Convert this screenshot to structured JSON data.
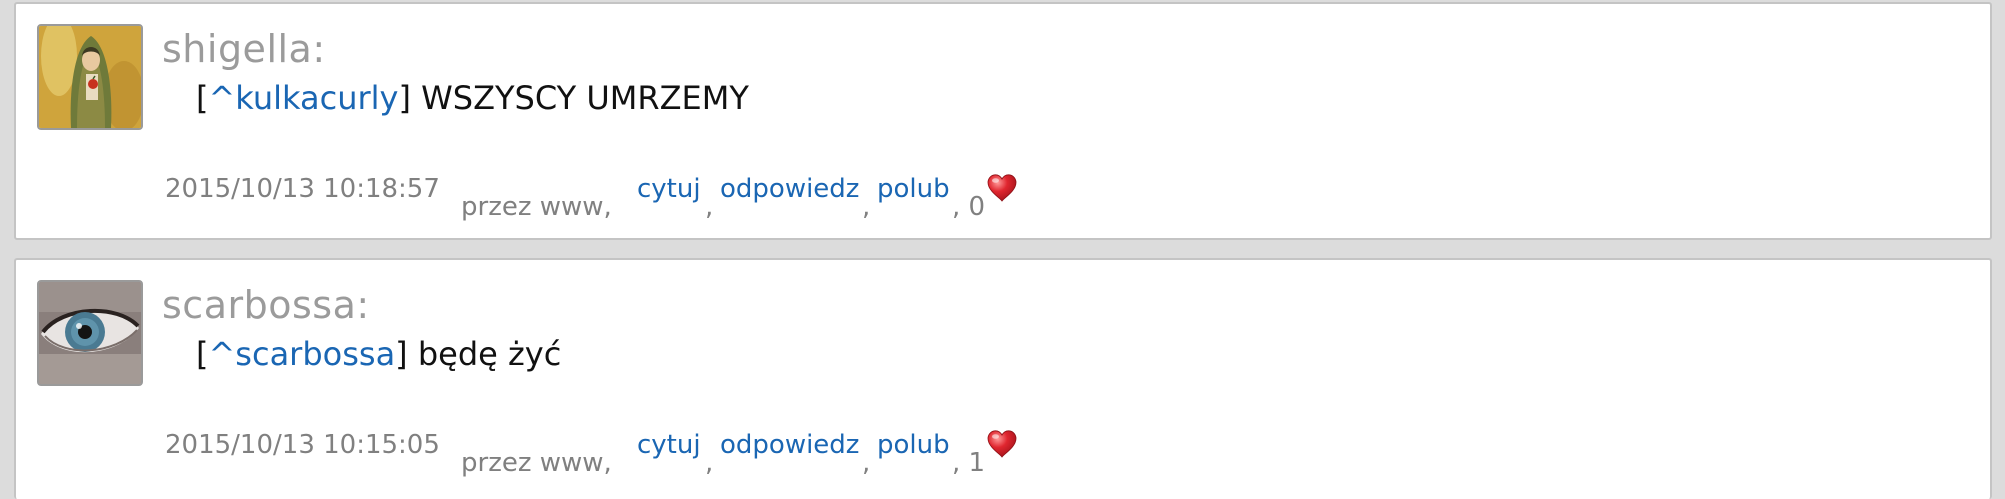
{
  "comments": [
    {
      "username": "shigella:",
      "reply_open": "[",
      "reply_to": "^kulkacurly",
      "reply_close": "]",
      "text": " WSZYSCY UMRZEMY",
      "timestamp": "2015/10/13 10:18:57",
      "via": "przez www,",
      "actions": {
        "quote": "cytuj",
        "reply": "odpowiedz",
        "like": "polub"
      },
      "separator": ",",
      "likes_text": ", 0",
      "avatar_icon": "woman-painting-avatar",
      "heart_color": "#e0262f"
    },
    {
      "username": "scarbossa:",
      "reply_open": "[",
      "reply_to": "^scarbossa",
      "reply_close": "]",
      "text": " będę żyć",
      "timestamp": "2015/10/13 10:15:05",
      "via": "przez www,",
      "actions": {
        "quote": "cytuj",
        "reply": "odpowiedz",
        "like": "polub"
      },
      "separator": ",",
      "likes_text": ", 1",
      "avatar_icon": "eye-photo-avatar",
      "heart_color": "#e0262f"
    }
  ],
  "colors": {
    "link": "#1a66b3",
    "meta": "#808080",
    "username": "#9b9b9b",
    "background": "#dcdcdc"
  }
}
